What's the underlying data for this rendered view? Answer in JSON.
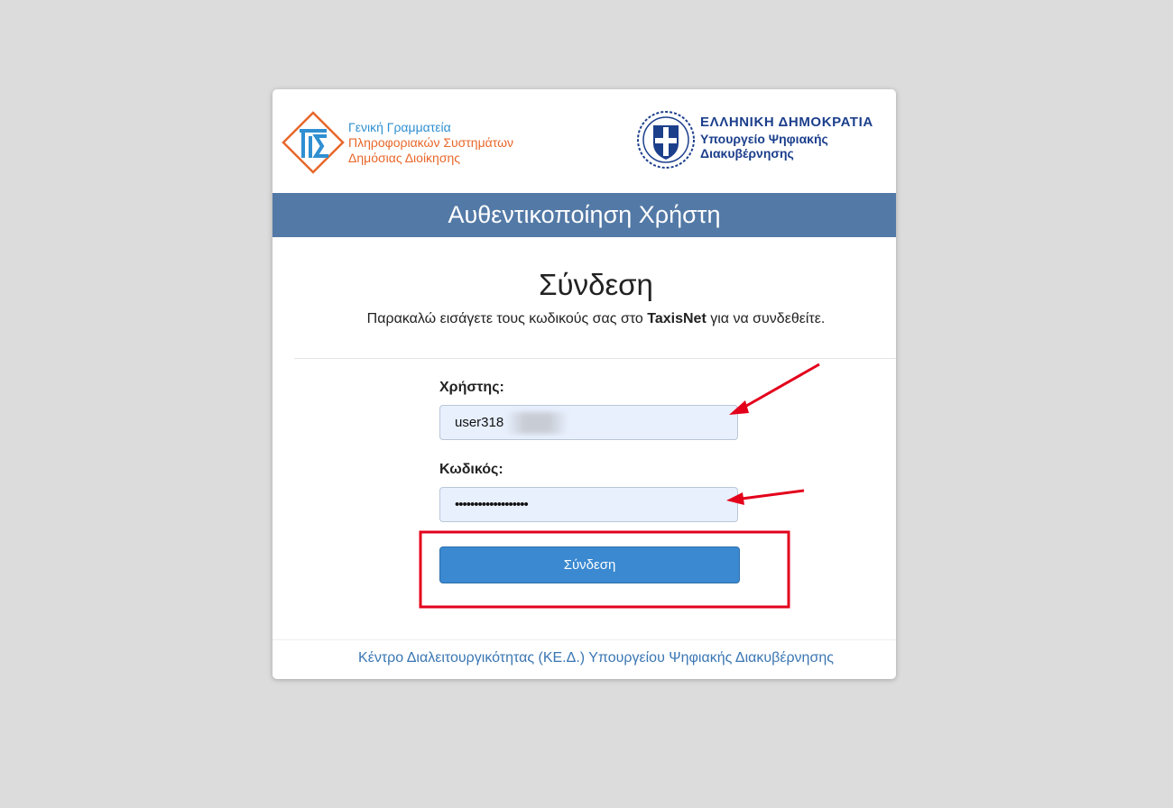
{
  "header": {
    "gsis": {
      "line1": "Γενική Γραμματεία",
      "line2": "Πληροφοριακών Συστημάτων",
      "line3": "Δημόσιας Διοίκησης"
    },
    "gov": {
      "line1": "ΕΛΛΗΝΙΚΗ ΔΗΜΟΚΡΑΤΙΑ",
      "line2": "Υπουργείο Ψηφιακής",
      "line3": "Διακυβέρνησης"
    }
  },
  "banner": {
    "title": "Αυθεντικοποίηση Χρήστη"
  },
  "login": {
    "title": "Σύνδεση",
    "description_before": "Παρακαλώ εισάγετε τους κωδικούς σας στο ",
    "description_bold": "TaxisNet",
    "description_after": " για να συνδεθείτε."
  },
  "form": {
    "username_label": "Χρήστης:",
    "username_value": "user318",
    "password_label": "Κωδικός:",
    "password_value": "•••••••••••••••••••",
    "submit_label": "Σύνδεση"
  },
  "footer": {
    "link_text": "Κέντρο Διαλειτουργικότητας (ΚΕ.Δ.) Υπουργείου Ψηφιακής Διακυβέρνησης"
  },
  "colors": {
    "banner": "#5379a6",
    "button": "#3a89d1",
    "annotation": "#e3001b",
    "gsis_blue": "#2f8fd1",
    "gsis_orange": "#e8672a",
    "gov_blue": "#1c3f8c"
  }
}
